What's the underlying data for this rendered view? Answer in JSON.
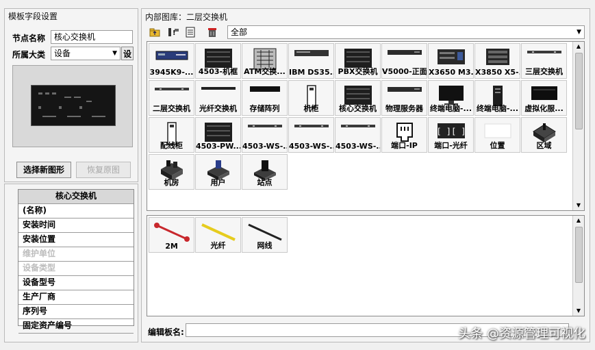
{
  "left_panel": {
    "title": "模板字段设置",
    "node_name_label": "节点名称",
    "node_name_value": "核心交换机",
    "category_label": "所属大类",
    "category_value": "设备",
    "set_button": "设",
    "select_image_button": "选择新图形",
    "restore_image_button": "恢复原图"
  },
  "properties": {
    "header": "核心交换机",
    "rows": [
      {
        "label": "(名称)",
        "disabled": false
      },
      {
        "label": "安装时间",
        "disabled": false
      },
      {
        "label": "安装位置",
        "disabled": false
      },
      {
        "label": "维护单位",
        "disabled": true
      },
      {
        "label": "设备类型",
        "disabled": true
      },
      {
        "label": "设备型号",
        "disabled": false
      },
      {
        "label": "生产厂商",
        "disabled": false
      },
      {
        "label": "序列号",
        "disabled": false
      },
      {
        "label": "固定资产编号",
        "disabled": false
      }
    ]
  },
  "right_panel": {
    "title": "内部图库：二层交换机",
    "filter_value": "全部",
    "toolbar_icons": [
      "folder-up-icon",
      "device-add-icon",
      "cabinet-icon",
      "delete-icon"
    ],
    "bottom_label": "编辑板名:"
  },
  "gallery_items": [
    {
      "label": "3945K9-...",
      "icon": "rack-unit-blue"
    },
    {
      "label": "4503-机框",
      "icon": "chassis-dark"
    },
    {
      "label": "ATM交换...",
      "icon": "atm-switch"
    },
    {
      "label": "IBM DS35...",
      "icon": "storage-flat"
    },
    {
      "label": "PBX交换机",
      "icon": "chassis-dark"
    },
    {
      "label": "V5000-正面",
      "icon": "rack-unit-thin"
    },
    {
      "label": "X3650 M3...",
      "icon": "server-1u"
    },
    {
      "label": "X3850 X5-...",
      "icon": "server-2u"
    },
    {
      "label": "三层交换机",
      "icon": "switch-line"
    },
    {
      "label": "二层交换机",
      "icon": "switch-line"
    },
    {
      "label": "光纤交换机",
      "icon": "switch-thin"
    },
    {
      "label": "存储阵列",
      "icon": "storage-bar"
    },
    {
      "label": "机柜",
      "icon": "cabinet"
    },
    {
      "label": "核心交换机",
      "icon": "chassis-dark"
    },
    {
      "label": "物理服务器",
      "icon": "rack-unit-thin"
    },
    {
      "label": "终端电脑-...",
      "icon": "monitor"
    },
    {
      "label": "终端电脑-...",
      "icon": "tower"
    },
    {
      "label": "虚拟化服...",
      "icon": "server-black"
    },
    {
      "label": "配线柜",
      "icon": "cabinet"
    },
    {
      "label": "4503-PW...",
      "icon": "chassis-dark"
    },
    {
      "label": "4503-WS-...",
      "icon": "switch-line"
    },
    {
      "label": "4503-WS-...",
      "icon": "switch-line"
    },
    {
      "label": "4503-WS-...",
      "icon": "switch-line"
    },
    {
      "label": "端口-IP",
      "icon": "port-ip"
    },
    {
      "label": "端口-光纤",
      "icon": "port-fiber"
    },
    {
      "label": "位置",
      "icon": "location-box"
    },
    {
      "label": "区域",
      "icon": "area-3d"
    },
    {
      "label": "机房",
      "icon": "room-3d"
    },
    {
      "label": "用户",
      "icon": "user-3d"
    },
    {
      "label": "站点",
      "icon": "site-3d"
    }
  ],
  "link_items": [
    {
      "label": "2M",
      "icon": "link-2m",
      "color": "#c8282d"
    },
    {
      "label": "光纤",
      "icon": "link-fiber",
      "color": "#e6cc1e"
    },
    {
      "label": "网线",
      "icon": "link-cable",
      "color": "#222222"
    }
  ],
  "watermark": "头条 @资源管理可视化"
}
